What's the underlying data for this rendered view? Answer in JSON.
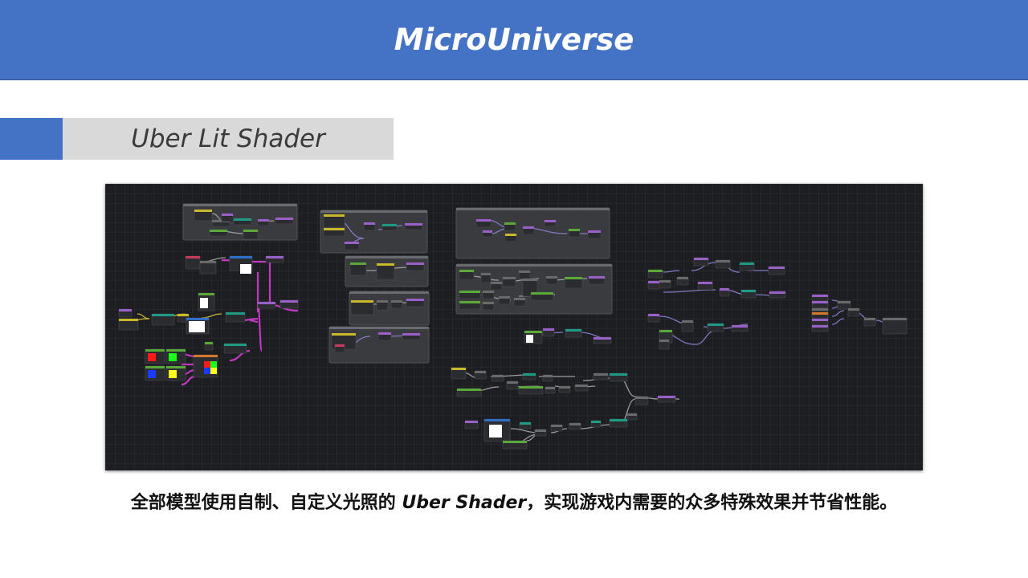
{
  "header": {
    "title": "MicroUniverse"
  },
  "section": {
    "title": "Uber Lit Shader"
  },
  "graph": {
    "label": "shader-node-graph",
    "colors": {
      "background": "#1d1e21",
      "group": "#3a3b3e",
      "node": "#2b2c2f",
      "wire_gray": "#a8a8b0",
      "wire_purple": "#8b82d6",
      "wire_magenta": "#d33bd3",
      "wire_yellow": "#d8c43a",
      "header_yellow": "#c8b82a",
      "header_green": "#5aa83a",
      "header_purple": "#9a5fc8",
      "header_teal": "#1f9a86",
      "header_blue": "#2f6fc8",
      "header_red": "#c83a5a",
      "header_orange": "#d27a2a",
      "header_gray": "#6a6a6a",
      "swatch_red": "#ff1a1a",
      "swatch_green": "#1aff1a",
      "swatch_blue": "#1a3aff",
      "swatch_yellow": "#ffff1a",
      "swatch_white": "#ffffff"
    }
  },
  "caption": {
    "prefix": "全部模型使用自制、自定义光照的 ",
    "em": "Uber Shader",
    "suffix": "，实现游戏内需要的众多特殊效果并节省性能。"
  }
}
